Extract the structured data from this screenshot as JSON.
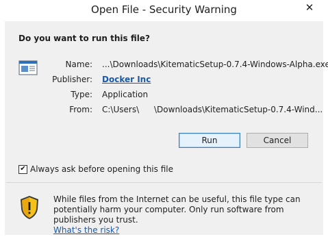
{
  "window": {
    "title": "Open File - Security Warning",
    "close_symbol": "✕"
  },
  "dialog": {
    "question": "Do you want to run this file?",
    "file_icon": "executable-file-icon",
    "fields": {
      "name_label": "Name:",
      "name_value": "...\\Downloads\\KitematicSetup-0.7.4-Windows-Alpha.exe",
      "publisher_label": "Publisher:",
      "publisher_value": "Docker Inc",
      "type_label": "Type:",
      "type_value": "Application",
      "from_label": "From:",
      "from_value_prefix": "C:\\Users\\",
      "from_value_suffix": "\\Downloads\\KitematicSetup-0.7.4-Wind..."
    },
    "buttons": {
      "run_label": "Run",
      "cancel_label": "Cancel"
    },
    "checkbox": {
      "label": "Always ask before opening this file",
      "checked": true,
      "check_mark": "✔"
    },
    "warning": {
      "icon": "security-shield-icon",
      "text": "While files from the Internet can be useful, this file type can potentially harm your computer. Only run software from publishers you trust.",
      "link_text": "What's the risk?"
    }
  },
  "colors": {
    "accent_link": "#1a5aa8",
    "dialog_bg": "#f0f0f0",
    "shield_yellow": "#f5c21a"
  }
}
